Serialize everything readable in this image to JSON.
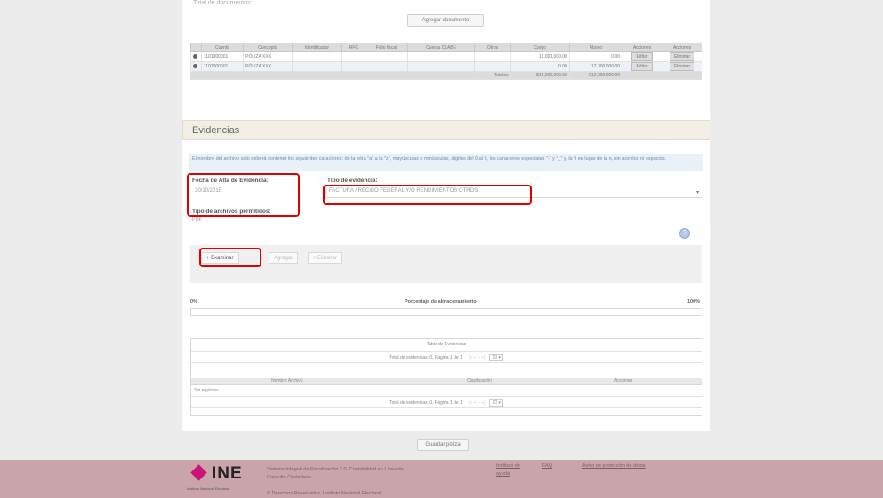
{
  "top": {
    "cut_text": "Total de documentos:",
    "add_doc_button": "Agregar documento"
  },
  "movements_table": {
    "headers": [
      "",
      "Cuenta",
      "Concepto",
      "Identificador",
      "RFC",
      "Folio fiscal",
      "Cuenta CLABE",
      "Otros",
      "Cargo",
      "Abono",
      "Acciones",
      "Acciones"
    ],
    "rows": [
      {
        "cuenta": "1101000001",
        "concepto": "PÓLIZA XXX",
        "cargo": "12,000,000.00",
        "abono": "0.00",
        "btn1": "Editar",
        "btn2": "Eliminar"
      },
      {
        "cuenta": "1101000001",
        "concepto": "PÓLIZA XXX",
        "cargo": "0.00",
        "abono": "12,000,000.00",
        "btn1": "Editar",
        "btn2": "Eliminar"
      }
    ],
    "totals_label": "Totales",
    "total_cargo": "$12,000,000.00",
    "total_abono": "$12,000,000.00"
  },
  "evidencias": {
    "title": "Evidencias",
    "info": "El nombre del archivo solo deberá contener los siguientes caracteres: de la letra \"a\" a la \"z\", mayúsculas o minúsculas, dígitos del 0 al 9, los caracteres especiales \"-\" y \"_\" y, la ñ en lugar de la n, sin acentos ni espacios.",
    "date_label": "Fecha de Alta de Evidencia:",
    "date_value": "30/10/2015",
    "type_label": "Tipo de evidencia:",
    "type_value": "FACTURA / RECIBO FEDERAL Y/O RENDIMIENTOS OTROS",
    "files_label": "Tipo de archivos permitidos:",
    "files_value": "PDF",
    "browse_button": "+ Examinar",
    "add_button": "Agregar",
    "remove_button": "× Eliminar",
    "progress_left": "0%",
    "progress_label": "Porcentaje de almacenamiento",
    "progress_right": "100%"
  },
  "ev_table": {
    "title": "Tabla de Evidencias",
    "pager_text": "Total de evidencias: 0, Página 1 de 1",
    "page_size": "10",
    "col1": "Nombre Archivo",
    "col2": "Clasificación",
    "col3": "Acciones",
    "empty": "Sin registros."
  },
  "save_button": "Guardar póliza",
  "footer": {
    "logo": "INE",
    "logo_sub": "Instituto Nacional Electoral",
    "desc_line1": "Sistema Integral de Fiscalización 2.0. Contabilidad en Línea de",
    "desc_line2": "Consulta Ciudadana",
    "copyright": "© Derechos Reservados, Instituto Nacional Electoral",
    "link1": "Instituto de",
    "link1b": "ayuda",
    "link2": "FAQ",
    "link3": "Aviso de protección de datos"
  }
}
